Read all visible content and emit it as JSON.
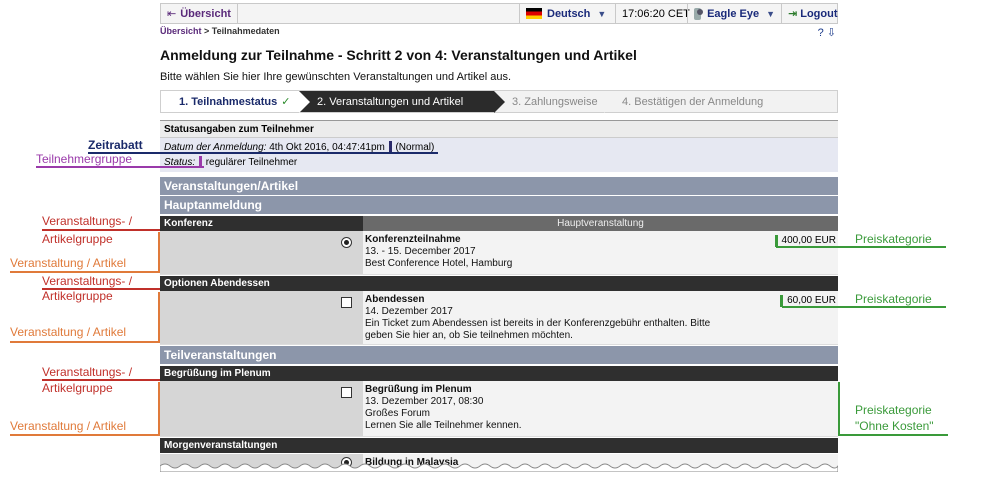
{
  "topbar": {
    "back_label": "Übersicht",
    "language": "Deutsch",
    "time": "17:06:20 CET",
    "user": "Eagle Eye",
    "logout": "Logout"
  },
  "breadcrumb": {
    "root": "Übersicht",
    "sep": " > ",
    "current": "Teilnahmedaten",
    "tools": "? ⇩"
  },
  "page": {
    "title": "Anmeldung zur Teilnahme - Schritt 2 von 4: Veranstaltungen und Artikel",
    "subtitle": "Bitte wählen Sie hier Ihre gewünschten Veranstaltungen und Artikel aus."
  },
  "wizard": {
    "steps": [
      "1. Teilnahmestatus",
      "2. Veranstaltungen und Artikel",
      "3. Zahlungsweise",
      "4. Bestätigen der Anmeldung"
    ],
    "check": "✓"
  },
  "status": {
    "heading": "Statusangaben zum Teilnehmer",
    "date_label": "Datum der Anmeldung:",
    "date_value": "4th Okt 2016, 04:47:41pm",
    "discount": "(Normal)",
    "status_label": "Status:",
    "status_value": "regulärer Teilnehmer"
  },
  "sections": {
    "main": "Veranstaltungen/Artikel",
    "haupt": "Hauptanmeldung",
    "teil": "Teilveranstaltungen"
  },
  "groups": {
    "konferenz": "Konferenz",
    "konferenz_right": "Hauptveranstaltung",
    "abendessen": "Optionen Abendessen",
    "plenum": "Begrüßung im Plenum",
    "morgen": "Morgenveranstaltungen"
  },
  "items": {
    "konf": {
      "name": "Konferenzteilnahme",
      "l1": "13. - 15. December 2017",
      "l2": "Best Conference Hotel, Hamburg",
      "price": "400,00 EUR"
    },
    "abend": {
      "name": "Abendessen",
      "l1": "14. Dezember 2017",
      "l2": "Ein Ticket zum Abendessen ist bereits in der Konferenzgebühr enthalten. Bitte",
      "l3": "geben Sie hier an, ob Sie teilnehmen möchten.",
      "price": "60,00 EUR"
    },
    "plenum": {
      "name": "Begrüßung im Plenum",
      "l1": "13. Dezember 2017, 08:30",
      "l2": "Großes Forum",
      "l3": "Lernen Sie alle Teilnehmer kennen."
    },
    "bildung": {
      "name": "Bildung in Malaysia"
    }
  },
  "annotations": {
    "zeitrabatt": "Zeitrabatt",
    "teilnehmergruppe": "Teilnehmergruppe",
    "vg1a": "Veranstaltungs- /",
    "vg1b": "Artikelgruppe",
    "va1": "Veranstaltung / Artikel",
    "vg2a": "Veranstaltungs- /",
    "vg2b": "Artikelgruppe",
    "va2": "Veranstaltung / Artikel",
    "vg3a": "Veranstaltungs- /",
    "vg3b": "Artikelgruppe",
    "va3": "Veranstaltung / Artikel",
    "pk1": "Preiskategorie",
    "pk2": "Preiskategorie",
    "pk3a": "Preiskategorie",
    "pk3b": "\"Ohne Kosten\""
  },
  "colors": {
    "annotation_red": "#c0302a",
    "annotation_orange": "#e07a3a",
    "annotation_green": "#3a9a3a",
    "annotation_navy": "#1a2a6a",
    "annotation_purple": "#9a3aaa",
    "section_bar": "#8c96aa",
    "group_bar": "#2f2f2f"
  }
}
